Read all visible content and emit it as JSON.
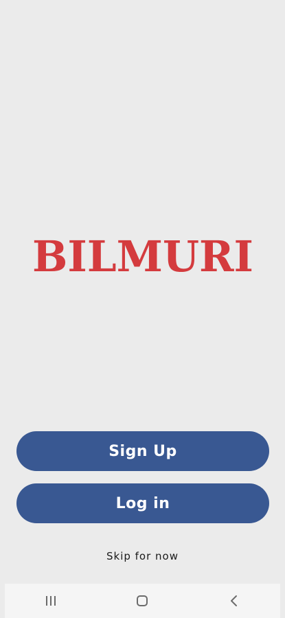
{
  "brand": {
    "logo_text": "BILMURI",
    "logo_color": "#d43b3e"
  },
  "actions": {
    "signup_label": "Sign Up",
    "login_label": "Log in",
    "skip_label": "Skip for now",
    "button_color": "#395892"
  },
  "navigation_bar": {
    "buttons": [
      "recent-apps-icon",
      "home-icon",
      "back-icon"
    ]
  }
}
